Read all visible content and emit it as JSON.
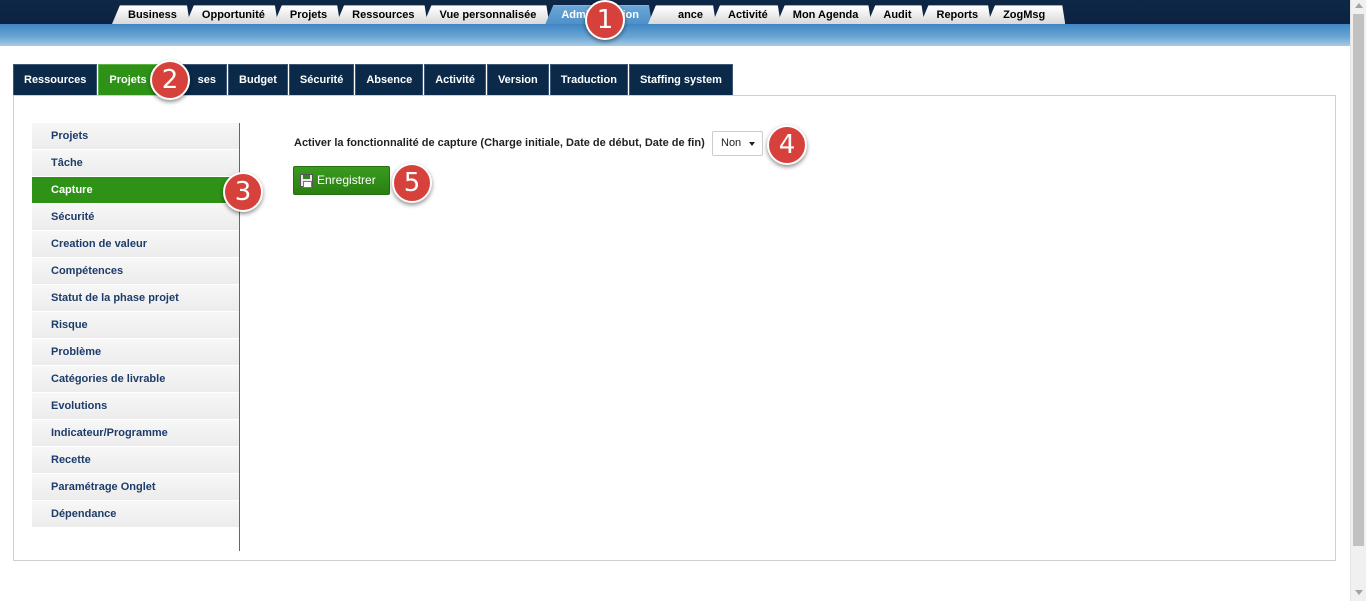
{
  "top_nav": {
    "tabs": [
      {
        "label": "Business",
        "active": false
      },
      {
        "label": "Opportunité",
        "active": false
      },
      {
        "label": "Projets",
        "active": false
      },
      {
        "label": "Ressources",
        "active": false
      },
      {
        "label": "Vue personnalisée",
        "active": false
      },
      {
        "label": "Administration",
        "active": true
      },
      {
        "label": "ance",
        "active": false
      },
      {
        "label": "Activité",
        "active": false
      },
      {
        "label": "Mon Agenda",
        "active": false
      },
      {
        "label": "Audit",
        "active": false
      },
      {
        "label": "Reports",
        "active": false
      },
      {
        "label": "ZogMsg",
        "active": false
      }
    ]
  },
  "sub_tabs": [
    {
      "label": "Ressources",
      "active": false
    },
    {
      "label": "Projets",
      "active": true
    },
    {
      "label": "ses",
      "active": false
    },
    {
      "label": "Budget",
      "active": false
    },
    {
      "label": "Sécurité",
      "active": false
    },
    {
      "label": "Absence",
      "active": false
    },
    {
      "label": "Activité",
      "active": false
    },
    {
      "label": "Version",
      "active": false
    },
    {
      "label": "Traduction",
      "active": false
    },
    {
      "label": "Staffing system",
      "active": false
    }
  ],
  "side_menu": [
    {
      "label": "Projets",
      "active": false
    },
    {
      "label": "Tâche",
      "active": false
    },
    {
      "label": "Capture",
      "active": true
    },
    {
      "label": "Sécurité",
      "active": false
    },
    {
      "label": "Creation de valeur",
      "active": false
    },
    {
      "label": "Compétences",
      "active": false
    },
    {
      "label": "Statut de la phase projet",
      "active": false
    },
    {
      "label": "Risque",
      "active": false
    },
    {
      "label": "Problème",
      "active": false
    },
    {
      "label": "Catégories de livrable",
      "active": false
    },
    {
      "label": "Evolutions",
      "active": false
    },
    {
      "label": "Indicateur/Programme",
      "active": false
    },
    {
      "label": "Recette",
      "active": false
    },
    {
      "label": "Paramétrage Onglet",
      "active": false
    },
    {
      "label": "Dépendance",
      "active": false
    }
  ],
  "form": {
    "capture_label": "Activer la fonctionnalité de capture (Charge initiale, Date de début, Date de fin)",
    "capture_value": "Non",
    "save_label": "Enregistrer"
  },
  "markers": [
    "1",
    "2",
    "3",
    "4",
    "5"
  ],
  "colors": {
    "nav_dark": "#0b2341",
    "accent_blue": "#4f90c7",
    "active_green": "#2e9217",
    "tab_dark": "#0b2a4a",
    "menu_text": "#1d3c6a",
    "marker_red": "#d7413b"
  }
}
